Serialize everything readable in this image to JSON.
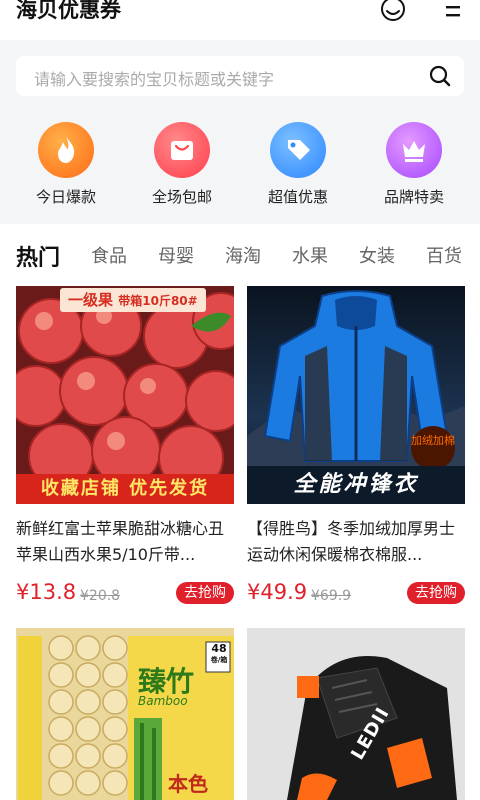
{
  "header": {
    "title": "海贝优惠券",
    "icons": [
      "smiley-icon",
      "menu-icon"
    ]
  },
  "search": {
    "placeholder": "请输入要搜索的宝贝标题或关键字"
  },
  "categories": [
    {
      "label": "今日爆款",
      "icon": "fire-icon",
      "color": "#ff7a1a"
    },
    {
      "label": "全场包邮",
      "icon": "shopping-bag-icon",
      "color": "#ff4a4f"
    },
    {
      "label": "超值优惠",
      "icon": "price-tag-icon",
      "color": "#2f8cff"
    },
    {
      "label": "品牌特卖",
      "icon": "crown-icon",
      "color": "#b84dff"
    }
  ],
  "tabs": [
    "热门",
    "食品",
    "母婴",
    "海淘",
    "水果",
    "女装",
    "百货"
  ],
  "products": [
    {
      "title": "新鲜红富士苹果脆甜冰糖心丑苹果山西水果5/10斤带...",
      "price": "¥13.8",
      "original_price": "¥20.8",
      "button": "去抢购",
      "image": {
        "top_label": "一级果",
        "top_label2": "带箱10斤80#",
        "bottom_label": "收藏店铺 优先发货"
      }
    },
    {
      "title": "【得胜鸟】冬季加绒加厚男士运动休闲保暖棉衣棉服...",
      "price": "¥49.9",
      "original_price": "¥69.9",
      "button": "去抢购",
      "image": {
        "bottom_label": "全能冲锋衣",
        "tag": "加绒加棉"
      }
    },
    {
      "title": "",
      "price": "",
      "original_price": "",
      "button": "",
      "image": {
        "badge": "48",
        "badge_unit": "卷/箱",
        "brand": "臻竹",
        "brand_en": "Bamboo",
        "sub": "本色"
      }
    },
    {
      "title": "",
      "price": "",
      "original_price": "",
      "button": "",
      "image": {
        "brand": "LEDII"
      }
    }
  ]
}
